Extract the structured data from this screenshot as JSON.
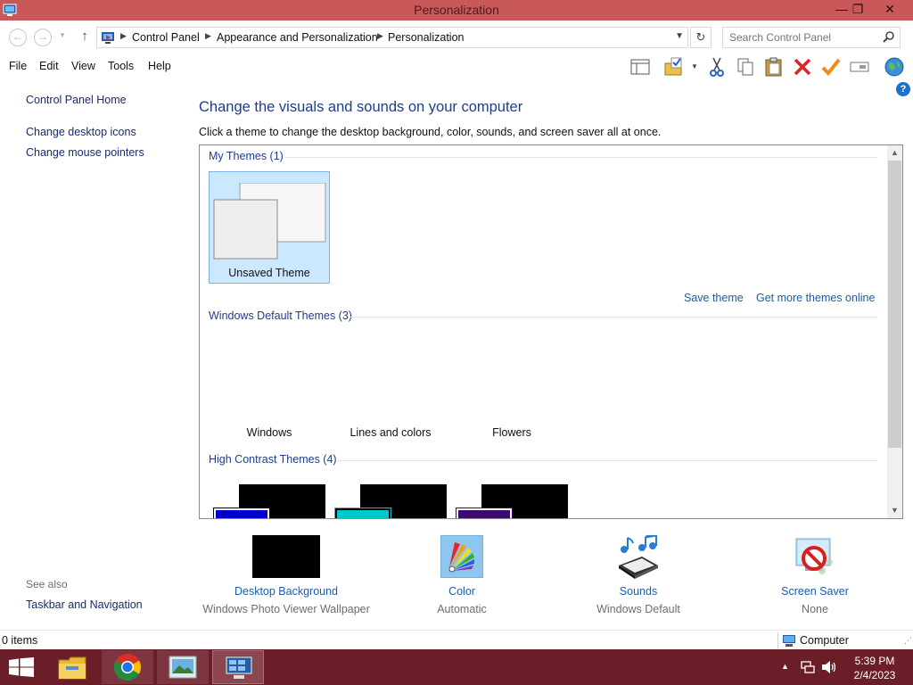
{
  "window": {
    "title": "Personalization",
    "minimize_glyph": "—",
    "restore_glyph": "❐",
    "close_glyph": "✕"
  },
  "address_bar": {
    "back_glyph": "←",
    "forward_glyph": "→",
    "up_glyph": "↑",
    "refresh_glyph": "↻",
    "breadcrumbs": [
      "Control Panel",
      "Appearance and Personalization",
      "Personalization"
    ],
    "search_placeholder": "Search Control Panel"
  },
  "menu": {
    "items": [
      "File",
      "Edit",
      "View",
      "Tools",
      "Help"
    ]
  },
  "toolbar_icons": [
    "layout-icon",
    "folder-check-icon",
    "cut-icon",
    "copy-icon",
    "paste-icon",
    "delete-icon",
    "checkmark-icon",
    "rename-icon",
    "globe-icon"
  ],
  "left_pane": {
    "home": "Control Panel Home",
    "links": [
      "Change desktop icons",
      "Change mouse pointers"
    ],
    "see_also_label": "See also",
    "see_also_links": [
      "Taskbar and Navigation"
    ]
  },
  "main": {
    "title": "Change the visuals and sounds on your computer",
    "description": "Click a theme to change the desktop background, color, sounds, and screen saver all at once."
  },
  "themes": {
    "my_themes": {
      "header": "My Themes (1)",
      "items": [
        "Unsaved Theme"
      ]
    },
    "save_theme": "Save theme",
    "get_more": "Get more themes online",
    "default_themes": {
      "header": "Windows Default Themes (3)",
      "items": [
        "Windows",
        "Lines and colors",
        "Flowers"
      ]
    },
    "high_contrast": {
      "header": "High Contrast Themes (4)",
      "swatch_colors": [
        "#0000c8",
        "#00c8c8",
        "#3c0a6e"
      ]
    }
  },
  "settings": [
    {
      "title": "Desktop Background",
      "subtitle": "Windows Photo Viewer Wallpaper"
    },
    {
      "title": "Color",
      "subtitle": "Automatic"
    },
    {
      "title": "Sounds",
      "subtitle": "Windows Default"
    },
    {
      "title": "Screen Saver",
      "subtitle": "None"
    }
  ],
  "status": {
    "items": "0 items",
    "location": "Computer"
  },
  "taskbar": {
    "time": "5:39 PM",
    "date": "2/4/2023",
    "tray_arrow": "▲"
  },
  "colors": {
    "titlebar": "#c8585a",
    "taskbar": "#6b1e27",
    "link": "#1a5ca8",
    "heading": "#1f3d8a",
    "selection": "#cce8ff"
  }
}
